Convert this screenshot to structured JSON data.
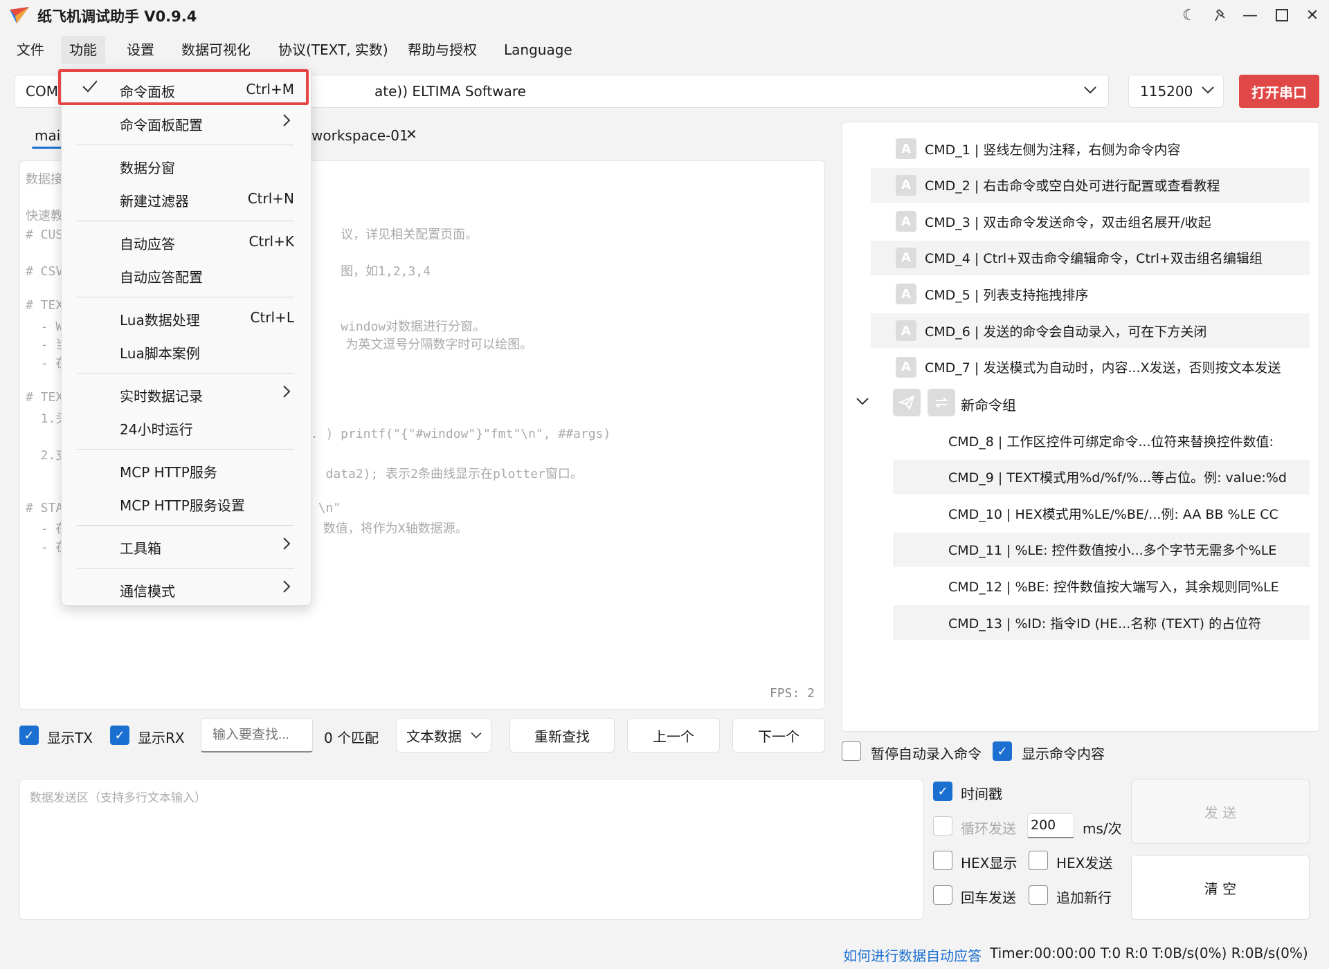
{
  "app": {
    "title": "纸飞机调试助手 V0.9.4"
  },
  "menubar": {
    "items": [
      "文件",
      "功能",
      "设置",
      "数据可视化",
      "协议(TEXT, 实数)",
      "帮助与授权",
      "Language"
    ]
  },
  "port": {
    "value": "COM",
    "value_suffix": "ate)) ELTIMA Software",
    "baud": "115200",
    "open_button": "打开串口"
  },
  "tabs": {
    "main": "mai",
    "workspace": "workspace-01"
  },
  "receive": {
    "lines": [
      "数据接",
      "",
      "快速教",
      "# CUS                                     议，详见相关配置页面。",
      "",
      "# CSV                                     图，如1,2,3,4",
      "",
      "# TEX",
      "  - W                                     window对数据进行分窗。",
      "  - 当                                     为英文逗号分隔数字时可以绘图。",
      "  - 在",
      "",
      "# TEX",
      "  1.头",
      "                                    ... ) printf(\"{\"#window\"}\"fmt\"\\n\", ##args)",
      "  2.支",
      "     E                                  data2); 表示2条曲线显示在plotter窗口。",
      "",
      "# STA                                  \\n\"",
      "  - 在                                  数值，将作为X轴数据源。",
      "  - 在"
    ],
    "fps": "FPS: 2"
  },
  "search": {
    "show_tx": "显示TX",
    "show_rx": "显示RX",
    "placeholder": "输入要查找...",
    "match_count": "0 个匹配",
    "data_type": "文本数据",
    "research": "重新查找",
    "prev": "上一个",
    "next": "下一个"
  },
  "commands": {
    "items": [
      "CMD_1 | 竖线左侧为注释，右侧为命令内容",
      "CMD_2 | 右击命令或空白处可进行配置或查看教程",
      "CMD_3 | 双击命令发送命令，双击组名展开/收起",
      "CMD_4 | Ctrl+双击命令编辑命令，Ctrl+双击组名编辑组",
      "CMD_5 | 列表支持拖拽排序",
      "CMD_6 | 发送的命令会自动录入，可在下方关闭",
      "CMD_7 | 发送模式为自动时，内容...X发送，否则按文本发送"
    ],
    "group_name": "新命令组",
    "group_items": [
      "CMD_8 | 工作区控件可绑定命令...位符来替换控件数值:",
      "CMD_9 | TEXT模式用%d/%f/%...等占位。例: value:%d",
      "CMD_10 | HEX模式用%LE/%BE/...例: AA BB %LE CC",
      "CMD_11 | %LE: 控件数值按小...多个字节无需多个%LE",
      "CMD_12 | %BE: 控件数值按大端写入，其余规则同%LE",
      "CMD_13 | %ID: 指令ID (HE...名称 (TEXT) 的占位符"
    ],
    "pause_auto_record": "暂停自动录入命令",
    "show_content": "显示命令内容"
  },
  "send": {
    "placeholder": "数据发送区（支持多行文本输入）",
    "timestamp": "时间戳",
    "loop_send": "循环发送",
    "interval": "200",
    "interval_unit": "ms/次",
    "hex_display": "HEX显示",
    "hex_send": "HEX发送",
    "enter_send": "回车发送",
    "append_newline": "追加新行",
    "send_button": "发 送",
    "clear_button": "清 空"
  },
  "func_menu": {
    "items": [
      {
        "label": "命令面板",
        "shortcut": "Ctrl+M"
      },
      {
        "label": "命令面板配置"
      },
      {
        "label": "数据分窗"
      },
      {
        "label": "新建过滤器",
        "shortcut": "Ctrl+N"
      },
      {
        "label": "自动应答",
        "shortcut": "Ctrl+K"
      },
      {
        "label": "自动应答配置"
      },
      {
        "label": "Lua数据处理",
        "shortcut": "Ctrl+L"
      },
      {
        "label": "Lua脚本案例"
      },
      {
        "label": "实时数据记录"
      },
      {
        "label": "24小时运行"
      },
      {
        "label": "MCP HTTP服务"
      },
      {
        "label": "MCP HTTP服务设置"
      },
      {
        "label": "工具箱"
      },
      {
        "label": "通信模式"
      }
    ]
  },
  "status": {
    "link": "如何进行数据自动应答",
    "text": "Timer:00:00:00  T:0  R:0   T:0B/s(0%)  R:0B/s(0%)"
  },
  "colors": {
    "accent": "#1a6fd0",
    "danger": "#e04848"
  }
}
